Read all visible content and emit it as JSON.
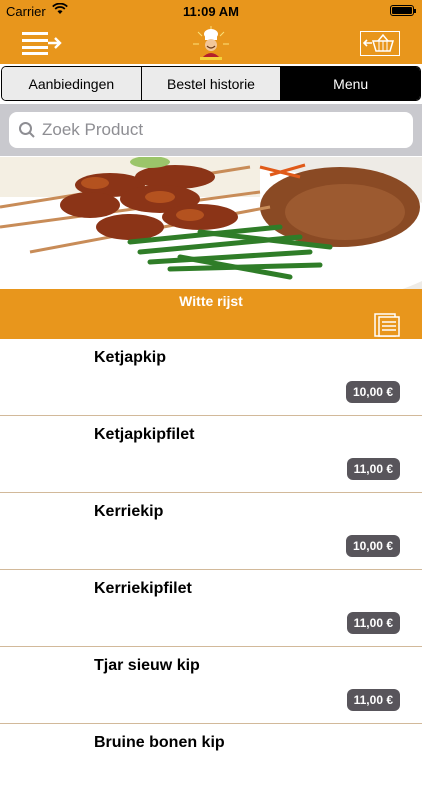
{
  "status_bar": {
    "carrier": "Carrier",
    "time": "11:09 AM"
  },
  "nav": {
    "menu_icon": "menu-arrow-icon",
    "logo": "chef-logo",
    "basket_icon": "basket-arrow-icon"
  },
  "tabs": [
    {
      "label": "Aanbiedingen",
      "active": false
    },
    {
      "label": "Bestel historie",
      "active": false
    },
    {
      "label": "Menu",
      "active": true
    }
  ],
  "search": {
    "placeholder": "Zoek Product",
    "value": ""
  },
  "category": {
    "title": "Witte rijst"
  },
  "items": [
    {
      "name": "Ketjapkip",
      "price": "10,00 €"
    },
    {
      "name": "Ketjapkipfilet",
      "price": "11,00 €"
    },
    {
      "name": "Kerriekip",
      "price": "10,00 €"
    },
    {
      "name": "Kerriekipfilet",
      "price": "11,00 €"
    },
    {
      "name": "Tjar sieuw kip",
      "price": "11,00 €"
    },
    {
      "name": "Bruine bonen kip",
      "price": ""
    }
  ],
  "colors": {
    "brand_orange": "#e8961c",
    "price_badge": "#58555b",
    "divider": "#d2b99a"
  }
}
